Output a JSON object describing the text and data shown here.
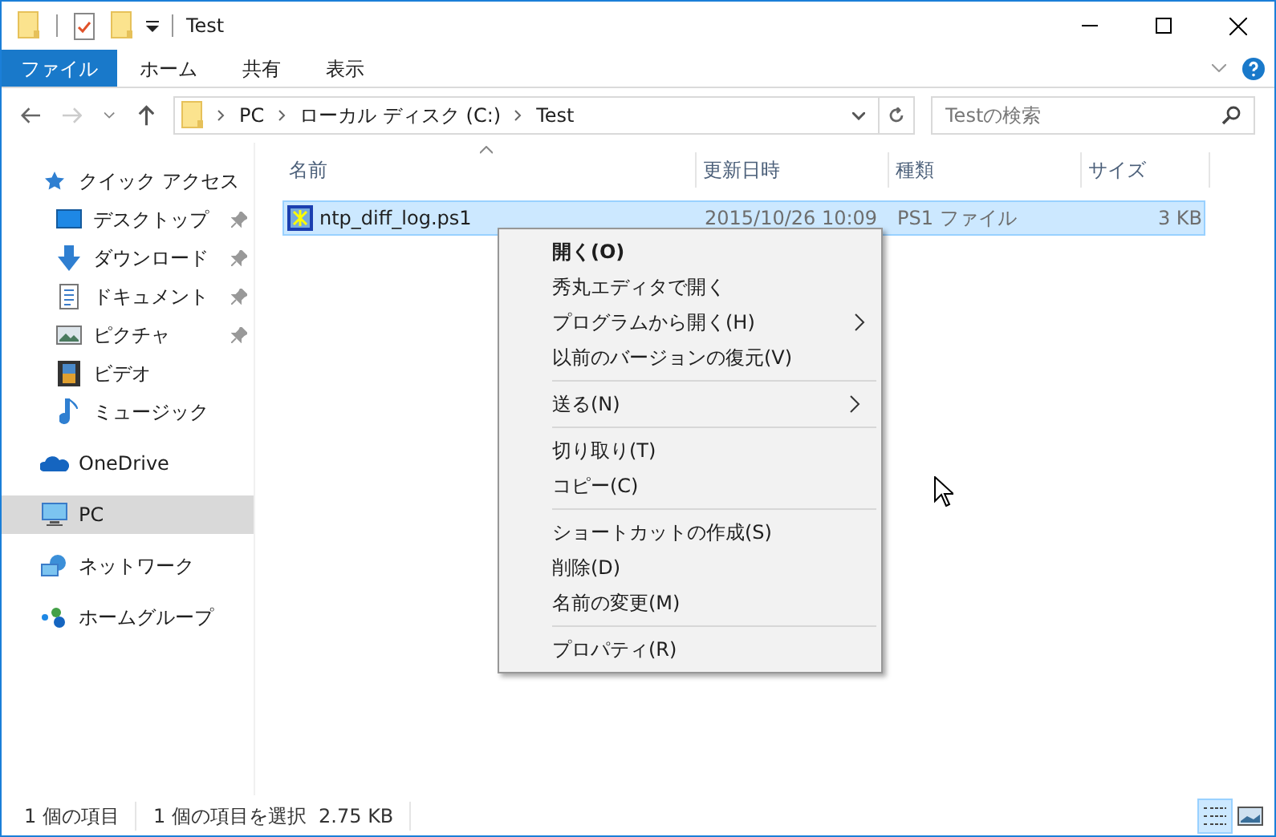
{
  "window": {
    "title": "Test"
  },
  "ribbon": {
    "tabs": [
      {
        "label": "ファイル",
        "selected": true
      },
      {
        "label": "ホーム",
        "selected": false
      },
      {
        "label": "共有",
        "selected": false
      },
      {
        "label": "表示",
        "selected": false
      }
    ]
  },
  "navigation": {
    "back_disabled": false,
    "forward_disabled": true
  },
  "address": {
    "crumbs": [
      "PC",
      "ローカル ディスク (C:)",
      "Test"
    ]
  },
  "search": {
    "placeholder": "Testの検索"
  },
  "sidebar": {
    "items": [
      {
        "label": "クイック アクセス",
        "pinned": false,
        "selected": false
      },
      {
        "label": "デスクトップ",
        "pinned": true,
        "selected": false
      },
      {
        "label": "ダウンロード",
        "pinned": true,
        "selected": false
      },
      {
        "label": "ドキュメント",
        "pinned": true,
        "selected": false
      },
      {
        "label": "ピクチャ",
        "pinned": true,
        "selected": false
      },
      {
        "label": "ビデオ",
        "pinned": false,
        "selected": false
      },
      {
        "label": "ミュージック",
        "pinned": false,
        "selected": false
      },
      {
        "label": "OneDrive",
        "pinned": false,
        "selected": false
      },
      {
        "label": "PC",
        "pinned": false,
        "selected": true
      },
      {
        "label": "ネットワーク",
        "pinned": false,
        "selected": false
      },
      {
        "label": "ホームグループ",
        "pinned": false,
        "selected": false
      }
    ]
  },
  "table": {
    "columns": [
      "名前",
      "更新日時",
      "種類",
      "サイズ"
    ],
    "rows": [
      {
        "name": "ntp_diff_log.ps1",
        "modified": "2015/10/26 10:09",
        "type": "PS1 ファイル",
        "size": "3 KB",
        "selected": true
      }
    ]
  },
  "context_menu": {
    "groups": [
      [
        {
          "label": "開く(O)",
          "bold": true,
          "submenu": false
        },
        {
          "label": "秀丸エディタで開く",
          "bold": false,
          "submenu": false
        },
        {
          "label": "プログラムから開く(H)",
          "bold": false,
          "submenu": true
        },
        {
          "label": "以前のバージョンの復元(V)",
          "bold": false,
          "submenu": false
        }
      ],
      [
        {
          "label": "送る(N)",
          "bold": false,
          "submenu": true
        }
      ],
      [
        {
          "label": "切り取り(T)",
          "bold": false,
          "submenu": false
        },
        {
          "label": "コピー(C)",
          "bold": false,
          "submenu": false
        }
      ],
      [
        {
          "label": "ショートカットの作成(S)",
          "bold": false,
          "submenu": false
        },
        {
          "label": "削除(D)",
          "bold": false,
          "submenu": false
        },
        {
          "label": "名前の変更(M)",
          "bold": false,
          "submenu": false
        }
      ],
      [
        {
          "label": "プロパティ(R)",
          "bold": false,
          "submenu": false
        }
      ]
    ]
  },
  "status_bar": {
    "items": [
      "1 個の項目",
      "1 個の項目を選択  2.75 KB"
    ],
    "views": [
      {
        "kind": "details",
        "selected": true
      },
      {
        "kind": "large-icons",
        "selected": false
      }
    ]
  }
}
